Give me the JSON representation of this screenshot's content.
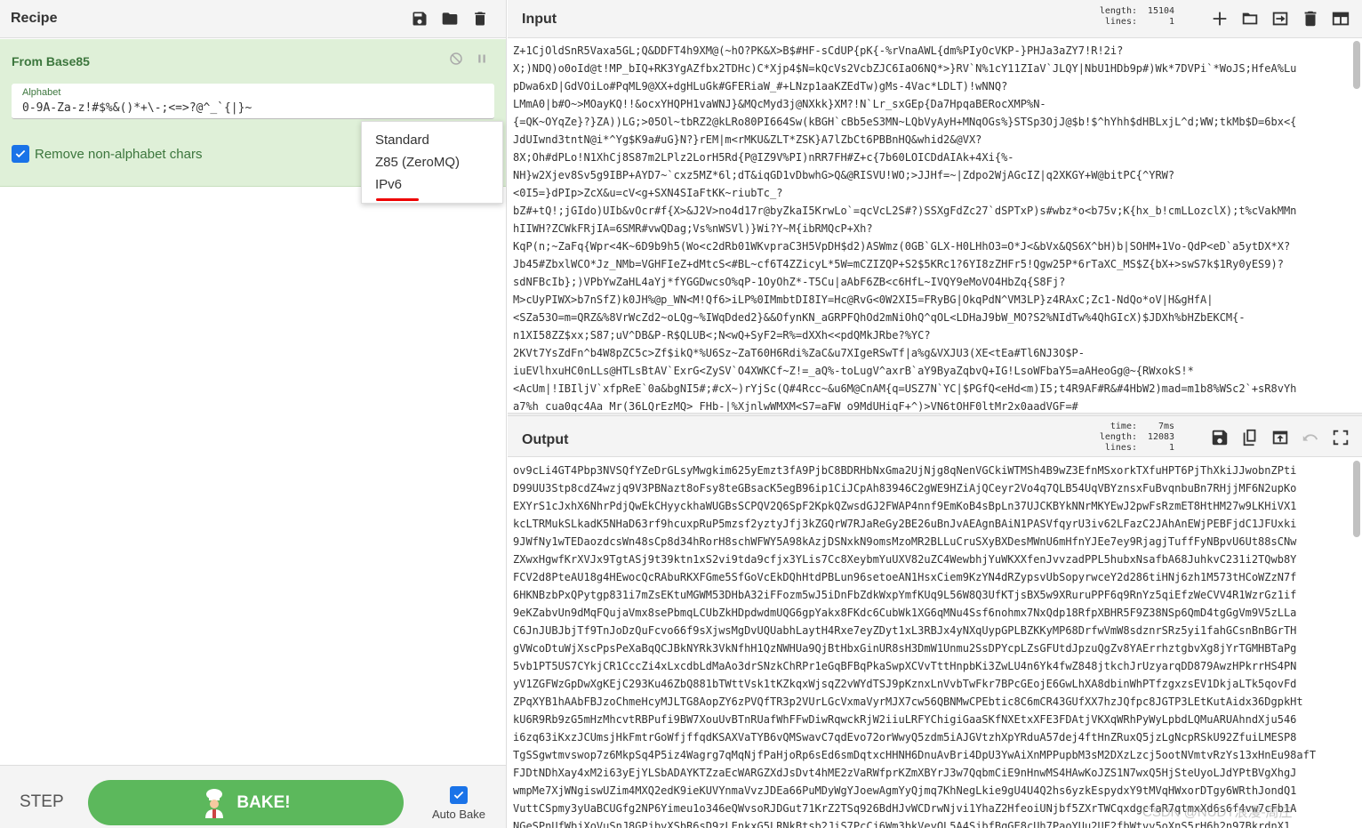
{
  "recipe": {
    "title": "Recipe",
    "operation": {
      "title": "From Base85",
      "alphabet_label": "Alphabet",
      "alphabet_value": "0-9A-Za-z!#$%&()*+\\-;<=>?@^_`{|}~",
      "remove_label": "Remove non-alphabet chars",
      "dropdown_options": [
        "Standard",
        "Z85 (ZeroMQ)",
        "IPv6"
      ],
      "selected_option": "IPv6"
    },
    "step_label": "STEP",
    "bake_label": "BAKE!",
    "autobake_label": "Auto Bake"
  },
  "input": {
    "title": "Input",
    "stats": {
      "length_label": "length:",
      "length": "15104",
      "lines_label": "lines:",
      "lines": "1"
    },
    "lines": [
      "Z+1CjOldSnR5Vaxa5GL;Q&DDFT4h9XM@(~hO?PK&X>B$#HF-sCdUP{pK{-%rVnaAWL{dm%PIyOcVKP-}PHJa3aZY7!R!2i?",
      "X;)NDQ)o0oId@t!MP_bIQ+RK3YgAZfbx2TDHc)C*Xjp4$N=kQcVs2VcbZJC6IaO6NQ*>}RV`N%1cY11ZIaV`JLQY|NbU1HDb9p#)Wk*7DVPi`*WoJS;HfeA%Lu",
      "pDwa6xD|GdVOiLo#PqML9@XX+dgHLuGk#GFERiaW_#+LNzp1aaKZEdTw)gMs-4Vac*LDLT)!wNNQ?",
      "LMmA0|b#O~>MOayKQ!!&ocxYHQPH1vaWNJ}&MQcMyd3j@NXkk}XM?!N`Lr_sxGEp{Da7HpqaBERocXMP%N-",
      "{=QK~OYqZe}?}ZA))LG;>05Ol~tbRZ2@kLRo80PI664Sw(kBGH`cBb5eS3MN~LQbVyAyH+MNqOGs%}STSp3OjJ@$b!$^hYhh$dHBLxjL^d;WW;tkMb$D=6bx<{",
      "JdUIwnd3tntN@i*^Yg$K9a#uG}N?}rEM|m<rMKU&ZLT*ZSK}A7lZbCt6PBBnHQ&whid2&@VX?",
      "8X;Oh#dPLo!N1XhCj8S87m2LPlz2LorH5Rd{P@IZ9V%PI)nRR7FH#Z+c{7b60LOICDdAIAk+4Xi{%-",
      "NH}w2Xjev8Sv5g9IBP+AYD7~`cxz5MZ*6l;dT&iqGD1vDbwhG>Q&@RISVU!WO;>JJHf=~|Zdpo2WjAGcIZ|q2XKGY+W@bitPC{^YRW?",
      "<0I5=}dPIp>ZcX&u=cV<g+SXN4SIaFtKK~riubTc_?",
      "bZ#+tQ!;jGIdo)UIb&vOcr#f{X>&J2V>no4d17r@byZkaI5KrwLo`=qcVcL2S#?)SSXgFdZc27`dSPTxP)s#wbz*o<b75v;K{hx_b!cmLLozclX);t%cVakMMn",
      "hIIWH?ZCWkFRjIA=6SMR#vwQDag;Vs%nWSVl)}Wi?Y~M{ibRMQcP+Xh?",
      "KqP(n;~ZaFq{Wpr<4K~6D9b9h5(Wo<c2dRb01WKvpraC3H5VpDH$d2)ASWmz(0GB`GLX-H0LHhO3=O*J<&bVx&QS6X^bH)b|SOHM+1Vo-QdP<eD`a5ytDX*X?",
      "Jb45#ZbxlWCO*Jz_NMb=VGHFIeZ+dMtcS<#BL~cf6T4ZZicyL*5W=mCZIZQP+S2$5KRc1?6YI8zZHFr5!Qgw25P*6rTaXC_MS$Z{bX+>swS7k$1Ry0yES9)?",
      "sdNFBcIb};)VPbYwZaHL4aYj*fYGGDwcsO%qP-1OyOhZ*-T5Cu|aAbF6ZB<c6HfL~IVQY9eMoVO4HbZq{S8Fj?",
      "M>cUyPIWX>b7nSfZ)k0JH%@p_WN<M!Qf6>iLP%0IMmbtDI8IY=Hc@RvG<0W2XI5=FRyBG|OkqPdN^VM3LP}z4RAxC;Zc1-NdQo*oV|H&gHfA|",
      "<SZa53O=m=QRZ&%8VrWcZd2~oLQg~%IWqDded2}&&OfynKN_aGRPFQhOd2mNiOhQ^qOL<LDHaJ9bW_MO?S2%NIdTw%4QhGIcX)$JDXh%bHZbEKCM{-",
      "n1XI58ZZ$xx;S87;uV^DB&P-R$QLUB<;N<wQ+SyF2=R%=dXXh<<pdQMkJRbe?%YC?",
      "2KVt7YsZdFn^b4W8pZC5c>Zf$ikQ*%U6Sz~ZaT60H6Rdi%ZaC&u7XIgeRSwTf|a%g&VXJU3(XE<tEa#Tl6NJ3O$P-",
      "iuEVlhxuHC0nLLs@HTLsBtAV`ExrG<ZySV`O4XWKCf~Z!=_aQ%-toLugV^axrB`aY9ByaZqbvQ+IG!LsoWFbaY5=aAHeoGg@~{RWxokS!*",
      "<AcUm|!IBIljV`xfpReE`0a&bgNI5#;#cX~)rYjSc(Q#4Rcc~&u6M@CnAM{q=USZ7N`YC|$PGfQ<eHd<m)I5;t4R9AF#R&#4HbW2)mad=m1b8%WSc2`+sR8vYh",
      "a7%h_cua0qc4Aa_Mr(36LQrEzMQ>_FHb-|%XjnlwWMXM<S7=aFW_o9MdUHiqF+^)>VN6tOHF0ltMr2x0aadVGF=#"
    ]
  },
  "output": {
    "title": "Output",
    "stats": {
      "time_label": "time:",
      "time": "7ms",
      "length_label": "length:",
      "length": "12083",
      "lines_label": "lines:",
      "lines": "1"
    },
    "lines": [
      "ov9cLi4GT4Pbp3NVSQfYZeDrGLsyMwgkim625yEmzt3fA9PjbC8BDRHbNxGma2UjNjg8qNenVGCkiWTMSh4B9wZ3EfnMSxorkTXfuHPT6PjThXkiJJwobnZPti",
      "D99UU3Stp8cdZ4wzjq9V3PBNazt8oFsy8teGBsacK5egB96ip1CiJCpAh83946C2gWE9HZiAjQCeyr2Vo4q7QLB54UqVBYznsxFuBvqnbuBn7RHjjMF6N2upKo",
      "EXYrS1cJxhX6NhrPdjQwEkCHyyckhaWUGBsSCPQV2Q6SpF2KpkQZwsdGJ2FWAP4nnf9EmKoB4sBpLn37UJCKBYkNNrMKYEwJ2pwFsRzmET8HtHM27w9LKHiVX1",
      "kcLTRMukSLkadK5NHaD63rf9hcuxpRuP5mzsf2yztyJfj3kZGQrW7RJaReGy2BE26uBnJvAEAgnBAiN1PASVfqyrU3iv62LFazC2JAhAnEWjPEBFjdC1JFUxki",
      "9JWfNy1wTEDaozdcsWn48sCp8d34hRorH8schWFWY5A98kAzjDSNxkN9omsMzoMR2BLLuCruSXyBXDesMWnU6mHfnYJEe7ey9RjagjTuffFyNBpvU6Ut88sCNw",
      "ZXwxHgwfKrXVJx9TgtASj9t39ktn1xS2vi9tda9cfjx3YLis7Cc8XeybmYuUXV82uZC4WewbhjYuWKXXfenJvvzadPPL5hubxNsafbA68JuhkvC231i2TQwb8Y",
      "FCV2d8PteAU18g4HEwocQcRAbuRKXFGme5SfGoVcEkDQhHtdPBLun96setoeAN1HsxCiem9KzYN4dRZypsvUbSopyrwceY2d286tiHNj6zh1M573tHCoWZzN7f",
      "6HKNBzbPxQPytgp831i7mZsEKtuMGWM53DHbA32iFFozm5wJ5iDnFbZdkWxpYmfKUq9L56W8Q3UfKTjsBX5w9XRuruPPF6q9RnYz5qiEfzWeCVV4R1WzrGz1if",
      "9eKZabvUn9dMqFQujaVmx8sePbmqLCUbZkHDpdwdmUQG6gpYakx8FKdc6CubWk1XG6qMNu4Ssf6nohmx7NxQdp18RfpXBHR5F9Z38NSp6QmD4tgGgVm9V5zLLa",
      "C6JnJUBJbjTf9TnJoDzQuFcvo66f9sXjwsMgDvUQUabhLaytH4Rxe7eyZDyt1xL3RBJx4yNXqUypGPLBZKKyMP68DrfwVmW8sdznrSRz5yi1fahGCsnBnBGrTH",
      "gVWcoDtuWjXscPpsPeXaBqQCJBkNYRk3VkNfhH1QzNWHUa9QjBtHbxGinUR8sH3DmW1Unmu2SsDPYcpLZsGFUtdJpzuQgZv8YAErrhztgbvXg8jYrTGMHBTaPg",
      "5vb1PT5US7CYkjCR1CccZi4xLxcdbLdMaAo3drSNzkChRPr1eGqBFBqPkaSwpXCVvTttHnpbKi3ZwLU4n6Yk4fwZ848jtkchJrUzyarqDD879AwzHPkrrHS4PN",
      "yV1ZGFWzGpDwXgKEjC293Ku46ZbQ881bTWttVsk1tKZkqxWjsqZ2vWYdTSJ9pKznxLnVvbTwFkr7BPcGEojE6GwLhXA8dbinWhPTfzgxzsEV1DkjaLTk5qovFd",
      "ZPqXYB1hAAbFBJzoChmeHcyMJLTG8AopZY6zPVQfTR3p2VUrLGcVxmaVyrMJX7cw56QBNMwCPEbtic8C6mCR43GUfXX7hzJQfpc8JGTP3LEtKutAidx36DgpkHt",
      "kU6R9Rb9zG5mHzMhcvtRBPufi9BW7XouUvBTnRUafWhFFwDiwRqwckRjW2iiuLRFYChigiGaaSKfNXEtxXFE3FDAtjVKXqWRhPyWyLpbdLQMuARUAhndXju546",
      "i6zq63iKxzJCUmsjHkFmtrGoWfjffqdKSAXVaTYB6vQMSwavC7qdEvo72orWwyQ5zdm5iAJGVtzhXpYRduA57dej4ftHnZRuxQ5jzLgNcpRSkU92ZfuiLMESP8",
      "TgSSgwtmvswop7z6MkpSq4P5iz4Wagrg7qMqNjfPaHjoRp6sEd6smDqtxcHHNH6DnuAvBri4DpU3YwAiXnMPPupbM3sM2DXzLzcj5ootNVmtvRzYs13xHnEu98afT",
      "FJDtNDhXay4xM2i63yEjYLSbADAYKTZzaEcWARGZXdJsDvt4hME2zVaRWfprKZmXBYrJ3w7QqbmCiE9nHnwMS4HAwKoJZS1N7wxQ5HjSteUyoLJdYPtBVgXhgJ",
      "wmpMe7XjWNgiswUZim4MXQ2edK9ieKUVYnmaVvzJDEa66PuMDyWgYJoewAgmYyQjmq7KhNegLkie9gU4U4Q2hs6yzkEspydxY9tMVqHWxorDTgy6WRthJondQ1",
      "VuttCSpmy3yUaBCUGfg2NP6Yimeu1o346eQWvsoRJDGut71KrZ2TSq926BdHJvWCDrwNjvi1YhaZ2HfeoiUNjbf5ZXrTWCqxdgcfaR7qtmxXd6s6f4vw7cFb1A",
      "NGeSPnUfWbjXoVuSnJ8GPjbvXSbR6sD9zLEnkxG5LRNkBtsb2JiS7PcCj6Wm3bkVeyQL5A4SjbfBqGE8cUh7PaoYUu2UF2fbWtvv5oXnS5rH6h2n97BkrdnX1"
    ]
  },
  "watermark": "CSDN @NUDT浪漫-周庄"
}
